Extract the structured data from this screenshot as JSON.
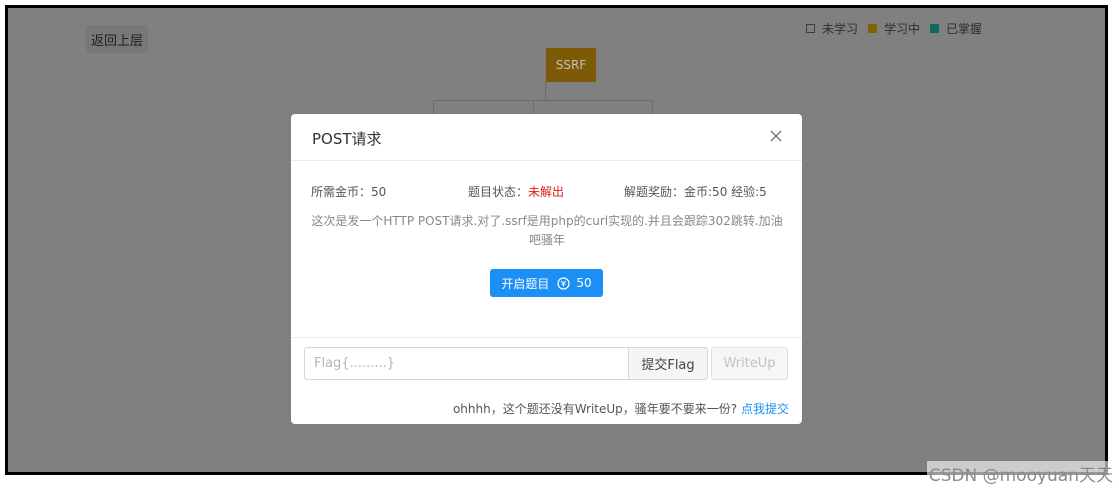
{
  "background": {
    "back_button": "返回上层",
    "legend": [
      {
        "label": "未学习",
        "color": "#ffffff"
      },
      {
        "label": "学习中",
        "color": "#ffc107"
      },
      {
        "label": "已掌握",
        "color": "#1ab394"
      }
    ],
    "root_node": "SSRF"
  },
  "modal": {
    "title": "POST请求",
    "cost_label": "所需金币：",
    "cost_value": "50",
    "status_label": "题目状态：",
    "status_value": "未解出",
    "reward_label": "解题奖励：",
    "reward_value": "金币:50 经验:5",
    "description": "这次是发一个HTTP POST请求.对了.ssrf是用php的curl实现的.并且会跟踪302跳转.加油吧骚年",
    "start_button": "开启题目",
    "start_cost": "50",
    "flag_placeholder": "Flag{.........}",
    "submit_button": "提交Flag",
    "writeup_button": "WriteUp",
    "note_text": "ohhhh，这个题还没有WriteUp，骚年要不要来一份?",
    "note_link": "点我提交"
  },
  "watermark": "CSDN @mooyuan天天",
  "colors": {
    "primary": "#1b8ff5",
    "status_unsolved": "#e21b1b"
  }
}
